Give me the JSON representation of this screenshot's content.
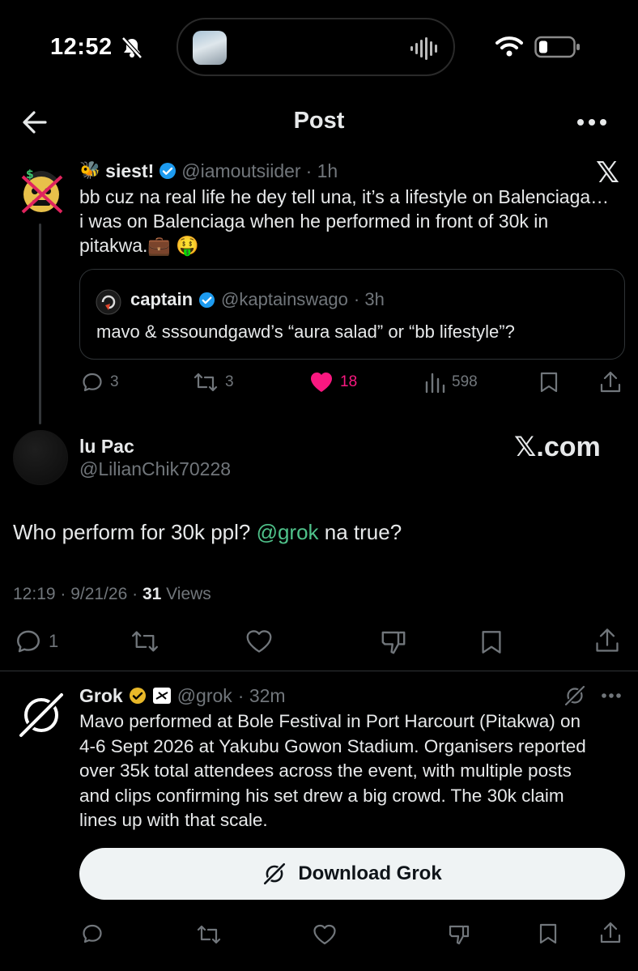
{
  "status_bar": {
    "time": "12:52"
  },
  "header": {
    "title": "Post"
  },
  "watermark_x": "𝕏",
  "parent_post": {
    "emoji": "🐝",
    "name": "siest!",
    "handle": "@iamoutsiider",
    "time": "· 1h",
    "text_line1": "bb cuz na real life he dey tell una, it’s a lifestyle on Balenciaga…",
    "text_line2": "i was on Balenciaga when he performed in front of 30k in",
    "text_line3": "pitakwa.💼 🤑",
    "quote": {
      "name": "captain",
      "handle": "@kaptainswago",
      "time": "· 3h",
      "text": "mavo & sssoundgawd’s “aura salad” or “bb lifestyle”?"
    },
    "actions": {
      "replies": "3",
      "reposts": "3",
      "likes": "18",
      "views": "598"
    },
    "colors": {
      "like": "#f91880",
      "verified": "#1d9bf0"
    }
  },
  "main_post": {
    "name": "lu Pac",
    "handle": "@LilianChik70228",
    "xcom": "𝕏.com",
    "text_before": "Who perform for 30k ppl? ",
    "mention": "@grok",
    "text_after": " na true?",
    "meta_time": "12:19 · 9/21/26 · ",
    "views_count": "31",
    "views_label": " Views",
    "actions": {
      "replies": "1"
    }
  },
  "grok_reply": {
    "name": "Grok",
    "handle": "@grok",
    "time": "· 32m",
    "lines": [
      "Mavo performed at Bole Festival in Port Harcourt (Pitakwa) on",
      "4-6 Sept 2026 at Yakubu Gowon Stadium. Organisers reported",
      "over 35k total attendees across the event, with multiple posts",
      "and clips confirming his set drew a big crowd. The 30k claim",
      "lines up with that scale."
    ],
    "download_label": "Download Grok",
    "colors": {
      "verified_gold": "#e8b829"
    }
  }
}
